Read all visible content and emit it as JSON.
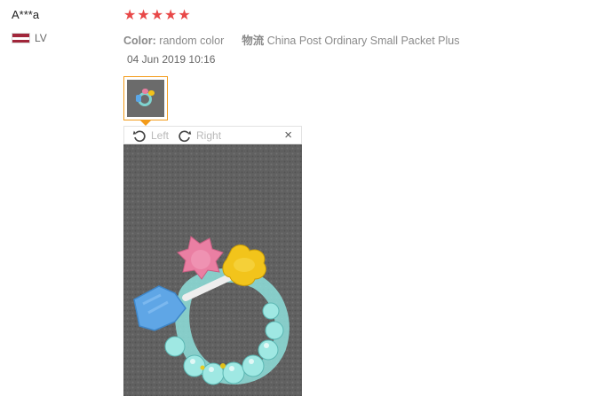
{
  "reviewer": {
    "name": "A***a",
    "country_code": "LV"
  },
  "rating": {
    "stars": 5,
    "max": 5,
    "star_glyph": "★",
    "color": "#e84848"
  },
  "attributes": {
    "color_label": "Color:",
    "color_value": "random color",
    "shipping_label": "物流",
    "shipping_value": "China Post Ordinary Small Packet Plus"
  },
  "date": "04 Jun 2019 10:16",
  "viewer": {
    "rotate_left_label": "Left",
    "rotate_right_label": "Right",
    "close_glyph": "×"
  },
  "colors": {
    "accent_border": "#f39b1a",
    "muted_text": "#8a8a8a"
  },
  "icons": [
    "rotate-left-icon",
    "rotate-right-icon",
    "close-icon",
    "star-icon",
    "latvia-flag-icon"
  ]
}
